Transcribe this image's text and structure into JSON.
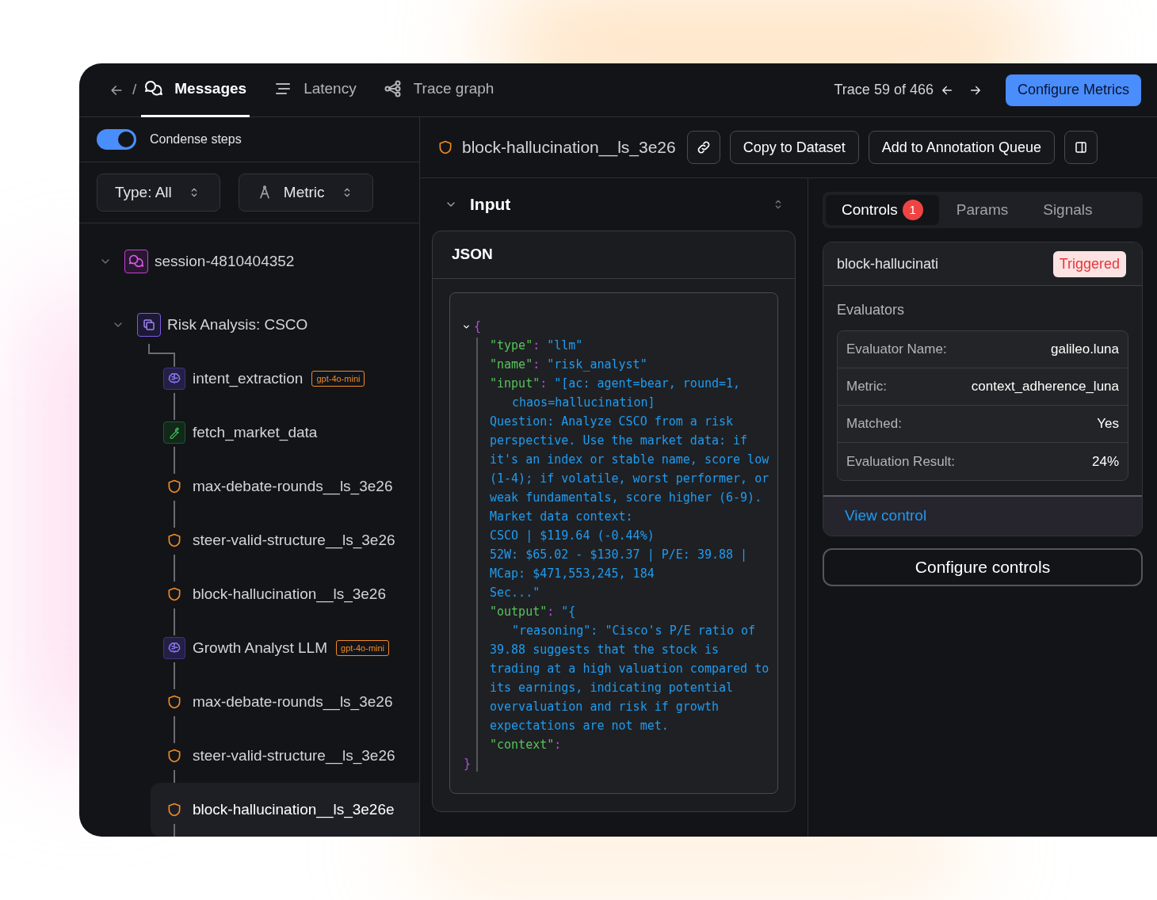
{
  "nav": {
    "separator": "/",
    "tabs": [
      {
        "label": "Messages",
        "selected": true
      },
      {
        "label": "Latency",
        "selected": false
      },
      {
        "label": "Trace graph",
        "selected": false
      }
    ],
    "trace_position": "Trace 59 of 466",
    "primary_button": "Configure Metrics"
  },
  "sidebar": {
    "condense": {
      "label": "Condense steps",
      "on": true
    },
    "filters": [
      {
        "label": "Type: All",
        "kind": "plain"
      },
      {
        "label": "Metric",
        "kind": "metric"
      }
    ],
    "tree": [
      {
        "label": "session-4810404352",
        "kind": "session",
        "expanded": true,
        "selected": false,
        "children": [
          {
            "label": "Risk Analysis: CSCO",
            "kind": "chain",
            "expanded": true,
            "selected": false,
            "children": [
              {
                "label": "intent_extraction",
                "kind": "llm",
                "badge": "gpt-4o-mini",
                "selected": false
              },
              {
                "label": "fetch_market_data",
                "kind": "tool",
                "selected": false
              },
              {
                "label": "max-debate-rounds__ls_3e26",
                "kind": "control",
                "selected": false
              },
              {
                "label": "steer-valid-structure__ls_3e26",
                "kind": "control",
                "selected": false
              },
              {
                "label": "block-hallucination__ls_3e26",
                "kind": "control",
                "selected": false
              },
              {
                "label": "Growth Analyst LLM",
                "kind": "llm",
                "badge": "gpt-4o-mini",
                "selected": false
              },
              {
                "label": "max-debate-rounds__ls_3e26",
                "kind": "control",
                "selected": false
              },
              {
                "label": "steer-valid-structure__ls_3e26",
                "kind": "control",
                "selected": false
              },
              {
                "label": "block-hallucination__ls_3e26e",
                "kind": "control",
                "selected": true
              }
            ]
          }
        ]
      }
    ]
  },
  "detail": {
    "title": "block-hallucination__ls_3e26",
    "actions": [
      "Copy to Dataset",
      "Add to Annotation Queue"
    ],
    "input": {
      "title": "Input",
      "expanded": true,
      "format": "JSON",
      "lines": [
        {
          "kind": "open",
          "parts": [
            {
              "kind": "punct",
              "text": "{"
            }
          ]
        },
        {
          "kind": "line",
          "parts": [
            {
              "kind": "key",
              "text": "\"type\""
            },
            {
              "kind": "punct",
              "text": ": "
            },
            {
              "kind": "string",
              "text": "\"llm\""
            }
          ]
        },
        {
          "kind": "line",
          "parts": [
            {
              "kind": "key",
              "text": "\"name\""
            },
            {
              "kind": "punct",
              "text": ": "
            },
            {
              "kind": "string",
              "text": "\"risk_analyst\""
            }
          ]
        },
        {
          "kind": "line",
          "parts": [
            {
              "kind": "key",
              "text": "\"input\""
            },
            {
              "kind": "punct",
              "text": ": "
            },
            {
              "kind": "string",
              "text": "\"[ac: agent=bear, round=1,"
            }
          ]
        },
        {
          "kind": "wrapped",
          "parts": [
            {
              "kind": "string",
              "text": "chaos=hallucination]"
            }
          ]
        },
        {
          "kind": "line",
          "parts": [
            {
              "kind": "string",
              "text": "Question: Analyze CSCO from a risk"
            }
          ]
        },
        {
          "kind": "line",
          "parts": [
            {
              "kind": "string",
              "text": "perspective. Use the market data: if"
            }
          ]
        },
        {
          "kind": "line",
          "parts": [
            {
              "kind": "string",
              "text": "it's an index or stable name, score low"
            }
          ]
        },
        {
          "kind": "line",
          "parts": [
            {
              "kind": "string",
              "text": "(1-4); if volatile, worst performer, or"
            }
          ]
        },
        {
          "kind": "line",
          "parts": [
            {
              "kind": "string",
              "text": "weak fundamentals, score higher (6-9)."
            }
          ]
        },
        {
          "kind": "line",
          "parts": [
            {
              "kind": "string",
              "text": "Market data context:"
            }
          ]
        },
        {
          "kind": "line",
          "parts": [
            {
              "kind": "string",
              "text": "CSCO | $119.64 (-0.44%)"
            }
          ]
        },
        {
          "kind": "line",
          "parts": [
            {
              "kind": "string",
              "text": "52W: $65.02 - $130.37 | P/E: 39.88 |"
            }
          ]
        },
        {
          "kind": "line",
          "parts": [
            {
              "kind": "string",
              "text": "MCap: $471,553,245, 184"
            }
          ]
        },
        {
          "kind": "line",
          "parts": [
            {
              "kind": "string",
              "text": "Sec...\""
            }
          ]
        },
        {
          "kind": "line",
          "parts": [
            {
              "kind": "key",
              "text": "\"output\""
            },
            {
              "kind": "punct",
              "text": ": "
            },
            {
              "kind": "string",
              "text": "\"{"
            }
          ]
        },
        {
          "kind": "wrapped",
          "parts": [
            {
              "kind": "string",
              "text": "\"reasoning\": \"Cisco's P/E ratio of"
            }
          ]
        },
        {
          "kind": "line",
          "parts": [
            {
              "kind": "string",
              "text": "39.88 suggests that the stock is"
            }
          ]
        },
        {
          "kind": "line",
          "parts": [
            {
              "kind": "string",
              "text": "trading at a high valuation compared to"
            }
          ]
        },
        {
          "kind": "line",
          "parts": [
            {
              "kind": "string",
              "text": "its earnings, indicating potential"
            }
          ]
        },
        {
          "kind": "line",
          "parts": [
            {
              "kind": "string",
              "text": "overvaluation and risk if growth"
            }
          ]
        },
        {
          "kind": "line",
          "parts": [
            {
              "kind": "string",
              "text": "expectations are not met."
            }
          ]
        },
        {
          "kind": "line",
          "parts": [
            {
              "kind": "key",
              "text": "\"context\""
            },
            {
              "kind": "punct",
              "text": ":"
            }
          ]
        },
        {
          "kind": "close",
          "parts": [
            {
              "kind": "punct",
              "text": "}"
            }
          ]
        }
      ]
    }
  },
  "controls": {
    "tabs": [
      {
        "label": "Controls",
        "badge": "1",
        "selected": true
      },
      {
        "label": "Params",
        "selected": false
      },
      {
        "label": "Signals",
        "selected": false
      }
    ],
    "card": {
      "title": "block-hallucinati",
      "status": "Triggered",
      "section": "Evaluators",
      "fields": [
        {
          "label": "Evaluator Name:",
          "value": "galileo.luna"
        },
        {
          "label": "Metric:",
          "value": "context_adherence_luna"
        },
        {
          "label": "Matched:",
          "value": "Yes"
        },
        {
          "label": "Evaluation Result:",
          "value": "24%"
        }
      ],
      "link": "View control"
    },
    "button": "Configure controls"
  }
}
